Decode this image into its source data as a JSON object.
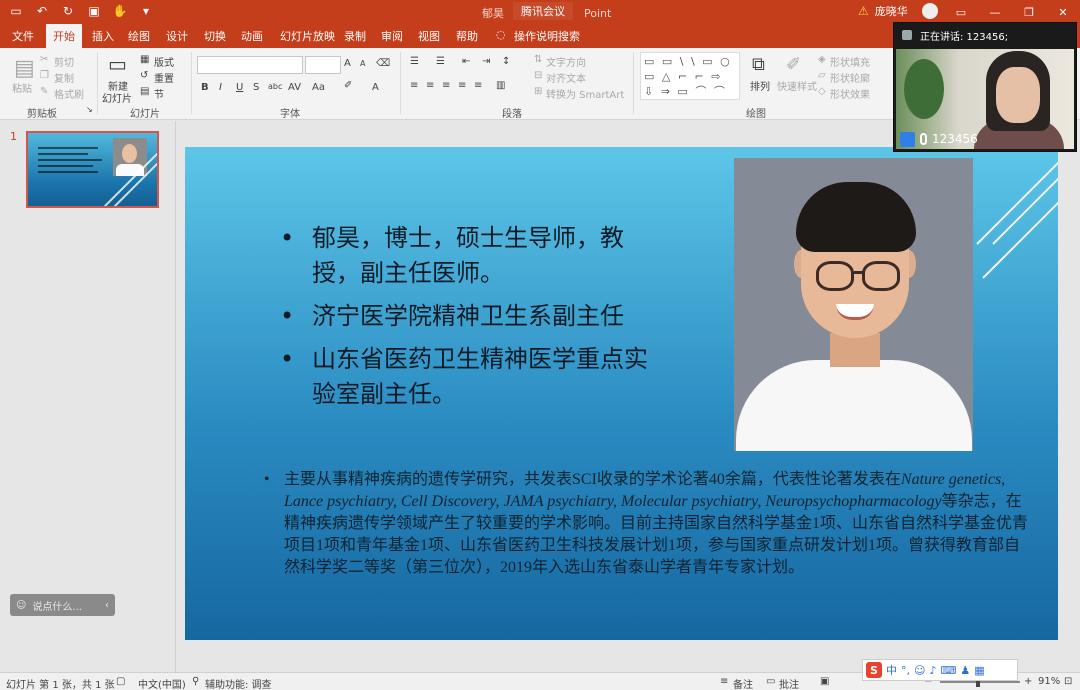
{
  "titlebar": {
    "doc_title": "郁昊",
    "doc_suffix": "Point",
    "meeting": "腾讯会议",
    "user_name": "庞晓华",
    "qat_icons": [
      "save-icon",
      "undo-icon",
      "redo-icon",
      "present-icon",
      "touch-icon",
      "more-icon"
    ]
  },
  "tabs": [
    "文件",
    "开始",
    "插入",
    "绘图",
    "设计",
    "切换",
    "动画",
    "幻灯片放映",
    "录制",
    "审阅",
    "视图",
    "帮助",
    "操作说明搜索"
  ],
  "ribbon": {
    "clipboard": {
      "paste": "粘贴",
      "cut": "剪切",
      "copy": "复制",
      "format_painter": "格式刷",
      "label": "剪贴板"
    },
    "slides": {
      "new_slide": "新建",
      "new_slide2": "幻灯片",
      "layout": "版式",
      "reset": "重置",
      "section": "节",
      "label": "幻灯片"
    },
    "font": {
      "label": "字体",
      "bold": "B",
      "italic": "I",
      "underline": "U",
      "strike": "S",
      "shadow": "abc",
      "spacing": "AV",
      "case": "Aa",
      "grow": "A",
      "shrink": "A"
    },
    "paragraph": {
      "label": "段落",
      "text_direction": "文字方向",
      "align_text": "对齐文本",
      "smartart": "转换为 SmartArt"
    },
    "drawing": {
      "label": "绘图",
      "arrange": "排列",
      "quick_styles": "快速样式",
      "shape_fill": "形状填充",
      "shape_outline": "形状轮廓",
      "shape_effects": "形状效果",
      "shapes": "▭ ▭ \\ \\ ▭ ○ ▭ △ ⌐ ⌐ ⇨ ⇩ ⇒ ▭ ⌒ ⌒ { }"
    }
  },
  "thumbnail": {
    "number": "1"
  },
  "chat": {
    "placeholder": "说点什么..."
  },
  "video": {
    "speaking": "正在讲话: 123456;",
    "name": "123456"
  },
  "slide": {
    "bullets": [
      "郁昊，博士，硕士生导师，教授，副主任医师。",
      "济宁医学院精神卫生系副主任",
      "山东省医药卫生精神医学重点实验室副主任。"
    ],
    "para_1": "主要从事精神疾病的遗传学研究，共发表SCI收录的学术论著40余篇，代表性论著发表在",
    "para_italic_1": "Nature genetics, Lance psychiatry, Cell Discovery, JAMA psychiatry, Molecular psychiatry, Neuropsychopharmacology",
    "para_2": "等杂志，在精神疾病遗传学领域产生了较重要的学术影响。目前主持国家自然科学基金1项、山东省自然科学基金优青项目1项和青年基金1项、山东省医药卫生科技发展计划1项，参与国家重点研发计划1项。曾获得教育部自然科学奖二等奖（第三位次），2019年入选山东省泰山学者青年专家计划。"
  },
  "statusbar": {
    "slide_info": "幻灯片 第 1 张，共 1 张",
    "language": "中文(中国)",
    "accessibility": "辅助功能: 调查",
    "notes": "备注",
    "comments": "批注",
    "zoom": "91%"
  },
  "ime": {
    "mode": "中",
    "punct": "°,"
  },
  "colors": {
    "accent": "#c43e1c",
    "slide_top": "#5dc6e8",
    "slide_bottom": "#1667a0"
  }
}
